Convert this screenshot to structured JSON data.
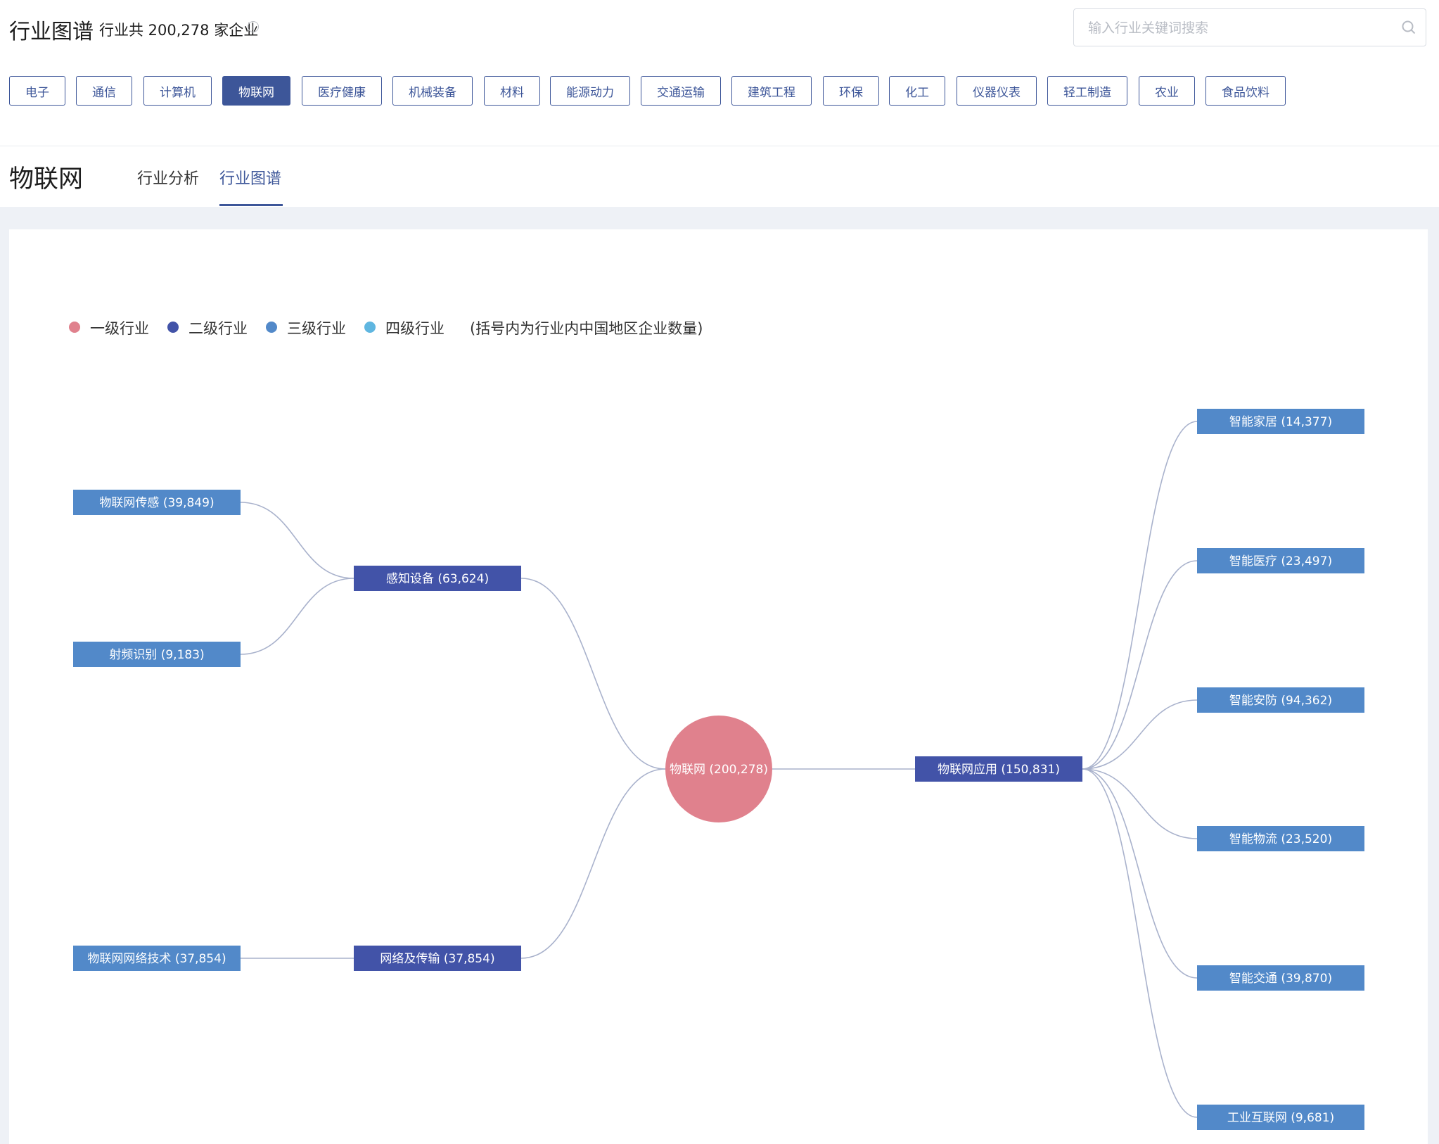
{
  "header": {
    "title": "行业图谱",
    "company_count": "行业共 200,278 家企业",
    "info_icon": "info-icon",
    "search_placeholder": "输入行业关键词搜索",
    "search_icon": "search-icon"
  },
  "industries": [
    {
      "label": "电子",
      "active": false
    },
    {
      "label": "通信",
      "active": false
    },
    {
      "label": "计算机",
      "active": false
    },
    {
      "label": "物联网",
      "active": true
    },
    {
      "label": "医疗健康",
      "active": false
    },
    {
      "label": "机械装备",
      "active": false
    },
    {
      "label": "材料",
      "active": false
    },
    {
      "label": "能源动力",
      "active": false
    },
    {
      "label": "交通运输",
      "active": false
    },
    {
      "label": "建筑工程",
      "active": false
    },
    {
      "label": "环保",
      "active": false
    },
    {
      "label": "化工",
      "active": false
    },
    {
      "label": "仪器仪表",
      "active": false
    },
    {
      "label": "轻工制造",
      "active": false
    },
    {
      "label": "农业",
      "active": false
    },
    {
      "label": "食品饮料",
      "active": false
    }
  ],
  "section": {
    "title": "物联网",
    "tabs": [
      {
        "label": "行业分析",
        "active": false
      },
      {
        "label": "行业图谱",
        "active": true
      }
    ]
  },
  "legend": {
    "items": [
      {
        "label": "一级行业",
        "color": "#e0818d"
      },
      {
        "label": "二级行业",
        "color": "#4253a8"
      },
      {
        "label": "三级行业",
        "color": "#5289c9"
      },
      {
        "label": "四级行业",
        "color": "#5fb6e0"
      }
    ],
    "note": "(括号内为行业内中国地区企业数量)"
  },
  "colors": {
    "accent": "#3d5699",
    "level1": "#e0818d",
    "level2": "#4253a8",
    "level3": "#5289c9",
    "link": "#a9b2cc"
  },
  "graph": {
    "root": {
      "name": "物联网",
      "count": "200,278"
    },
    "nodes": [
      {
        "id": "sensing",
        "name": "感知设备",
        "count": "63,624",
        "level": 2
      },
      {
        "id": "network",
        "name": "网络及传输",
        "count": "37,854",
        "level": 2
      },
      {
        "id": "app",
        "name": "物联网应用",
        "count": "150,831",
        "level": 2
      },
      {
        "id": "iot-sensor",
        "name": "物联网传感",
        "count": "39,849",
        "level": 3
      },
      {
        "id": "rfid",
        "name": "射频识别",
        "count": "9,183",
        "level": 3
      },
      {
        "id": "iot-net-tech",
        "name": "物联网网络技术",
        "count": "37,854",
        "level": 3
      },
      {
        "id": "smart-home",
        "name": "智能家居",
        "count": "14,377",
        "level": 3
      },
      {
        "id": "smart-medical",
        "name": "智能医疗",
        "count": "23,497",
        "level": 3
      },
      {
        "id": "smart-security",
        "name": "智能安防",
        "count": "94,362",
        "level": 3
      },
      {
        "id": "smart-logistics",
        "name": "智能物流",
        "count": "23,520",
        "level": 3
      },
      {
        "id": "smart-traffic",
        "name": "智能交通",
        "count": "39,870",
        "level": 3
      },
      {
        "id": "industrial-internet",
        "name": "工业互联网",
        "count": "9,681",
        "level": 3
      }
    ],
    "edges": [
      [
        "root",
        "sensing"
      ],
      [
        "root",
        "network"
      ],
      [
        "root",
        "app"
      ],
      [
        "sensing",
        "iot-sensor"
      ],
      [
        "sensing",
        "rfid"
      ],
      [
        "network",
        "iot-net-tech"
      ],
      [
        "app",
        "smart-home"
      ],
      [
        "app",
        "smart-medical"
      ],
      [
        "app",
        "smart-security"
      ],
      [
        "app",
        "smart-logistics"
      ],
      [
        "app",
        "smart-traffic"
      ],
      [
        "app",
        "industrial-internet"
      ]
    ]
  }
}
